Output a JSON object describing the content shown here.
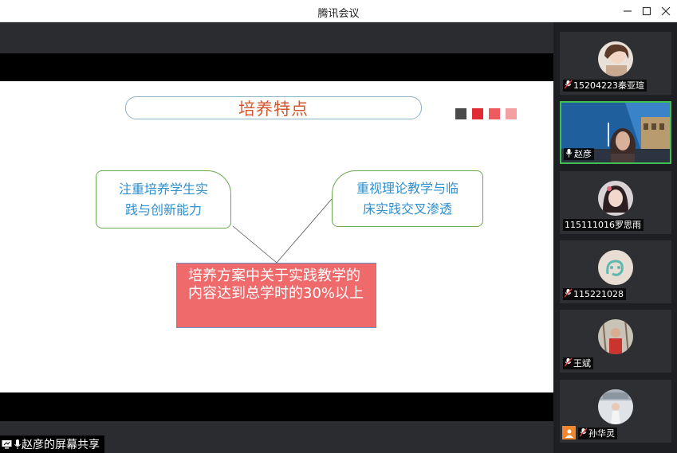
{
  "window": {
    "title": "腾讯会议",
    "controls": [
      "minimize-icon",
      "maximize-icon",
      "close-icon"
    ]
  },
  "share": {
    "label": "赵彦的屏幕共享"
  },
  "slide": {
    "title": "培养特点",
    "square_colors": [
      "#4a4a4a",
      "#e02b35",
      "#ef5a60",
      "#f3a0a3"
    ],
    "left_box": [
      "注重培养学生实",
      "践与创新能力"
    ],
    "right_box": [
      "重视理论教学与临",
      "床实践交叉渗透"
    ],
    "center_box": "培养方案中关于实践教学的内容达到总学时的30%以上"
  },
  "participants": [
    {
      "name": "15204223秦亚瑄",
      "muted": true,
      "video": false
    },
    {
      "name": "赵彦",
      "muted": false,
      "video": true,
      "active": true
    },
    {
      "name": "115111016罗思雨",
      "muted": false,
      "video": false
    },
    {
      "name": "115221028",
      "muted": true,
      "video": false
    },
    {
      "name": "王斌",
      "muted": true,
      "video": false
    },
    {
      "name": "孙华灵",
      "muted": true,
      "video": false,
      "camera_off_badge": true
    }
  ],
  "colors": {
    "active_border": "#3fbf52",
    "title_text": "#d4572b",
    "box_text": "#2f8fcf",
    "center_fill": "#ee6a6b"
  }
}
